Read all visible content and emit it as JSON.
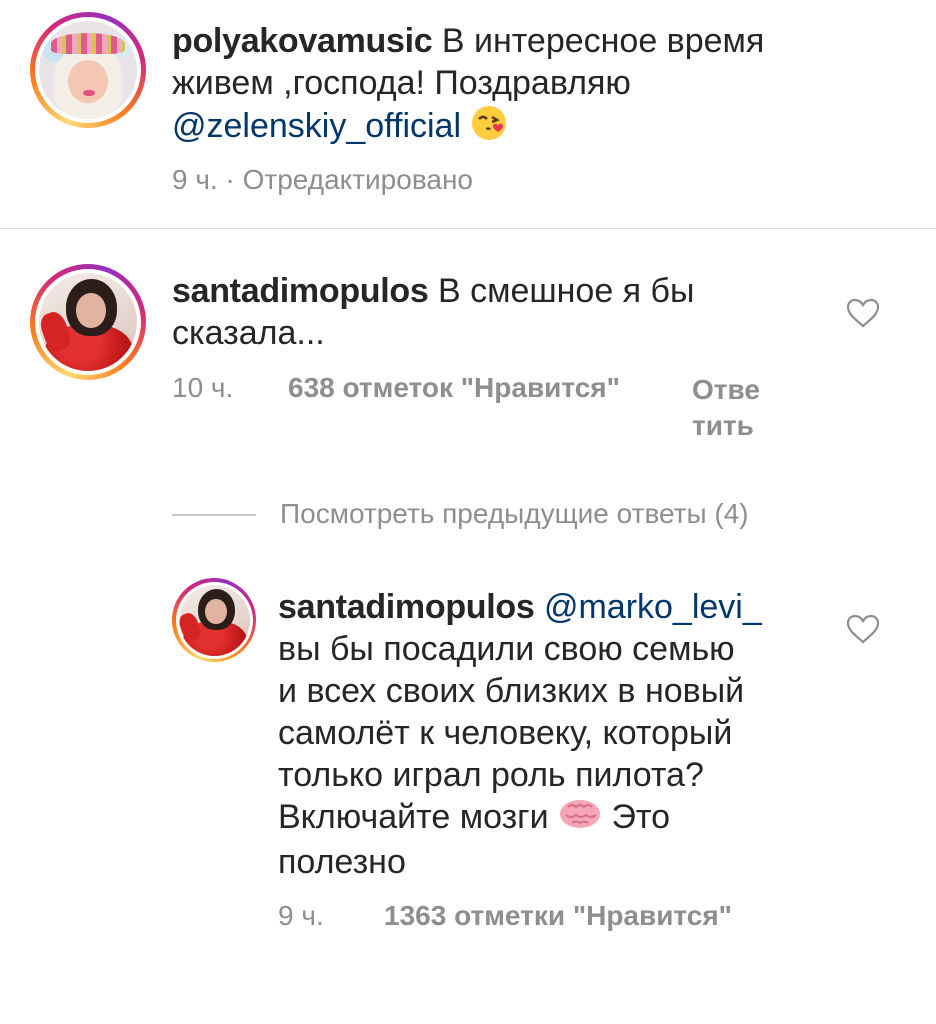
{
  "comments": [
    {
      "username": "polyakovamusic",
      "text_line1": " В интересное время",
      "text_line2": "живем ,господа! Поздравляю",
      "mention": "@zelenskiy_official",
      "emoji": "face-blowing-kiss",
      "time": "9 ч.",
      "separator": " · ",
      "edited": "Отредактировано"
    },
    {
      "username": "santadimopulos",
      "text_line1": " В смешное я бы",
      "text_line2": "сказала...",
      "time": "10 ч.",
      "likes": "638 отметок \"Нравится\"",
      "reply_line1": "Отве",
      "reply_line2": "тить",
      "like_icon": "heart-outline-icon"
    }
  ],
  "view_replies": "Посмотреть предыдущие ответы (4)",
  "reply": {
    "username": "santadimopulos",
    "mention": "@marko_levi_",
    "lines": [
      "вы бы посадили свою семью",
      "и всех своих близких в новый",
      "самолёт к человеку, который",
      "только играл роль пилота?"
    ],
    "line5_before": "Включайте мозги ",
    "emoji": "brain",
    "line5_after": " Это",
    "line6": "полезно",
    "time": "9 ч.",
    "likes": "1363 отметки \"Нравится\"",
    "like_icon": "heart-outline-icon"
  },
  "colors": {
    "text": "#262626",
    "meta": "#8e8e8e",
    "mention": "#00376b",
    "divider": "#dbdbdb"
  }
}
